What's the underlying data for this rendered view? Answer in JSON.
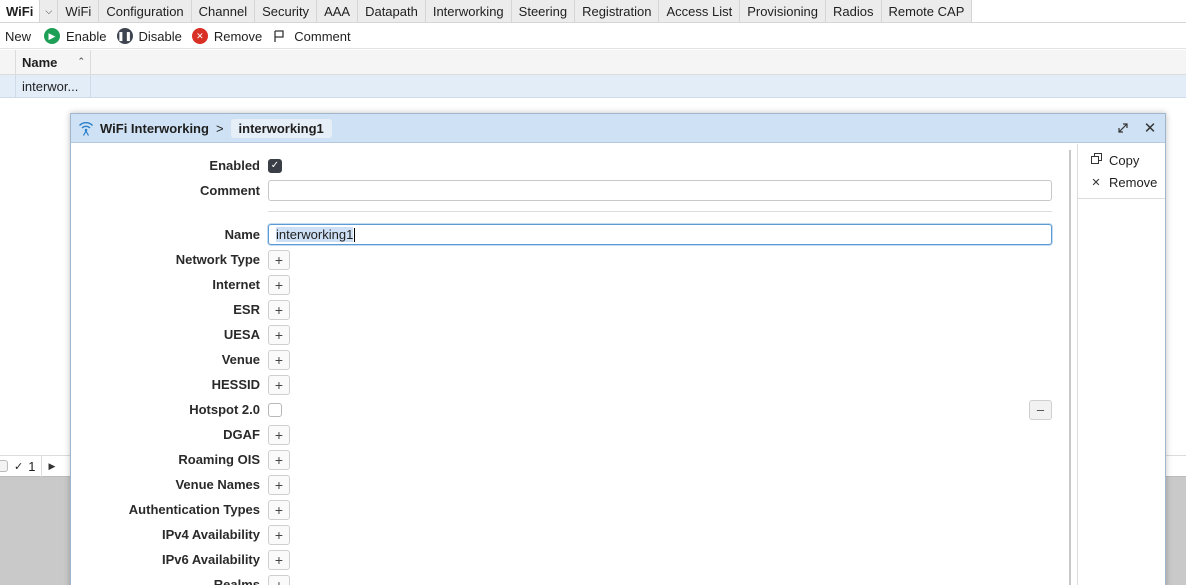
{
  "tabs": {
    "active": "WiFi",
    "items": [
      "WiFi",
      "Configuration",
      "Channel",
      "Security",
      "AAA",
      "Datapath",
      "Interworking",
      "Steering",
      "Registration",
      "Access List",
      "Provisioning",
      "Radios",
      "Remote CAP"
    ]
  },
  "toolbar": {
    "new_label": "New",
    "enable_label": "Enable",
    "disable_label": "Disable",
    "remove_label": "Remove",
    "comment_label": "Comment"
  },
  "table": {
    "columns": [
      "Name"
    ],
    "rows": [
      {
        "name": "interwor..."
      }
    ]
  },
  "statusbar": {
    "count": "1"
  },
  "dialog": {
    "title": "WiFi Interworking",
    "separator": ">",
    "item_name": "interworking1",
    "side_actions": {
      "copy_label": "Copy",
      "remove_label": "Remove"
    },
    "fields": {
      "enabled": {
        "label": "Enabled",
        "checked": true
      },
      "comment": {
        "label": "Comment",
        "value": ""
      },
      "name": {
        "label": "Name",
        "value": "interworking1"
      },
      "network_type": {
        "label": "Network Type"
      },
      "internet": {
        "label": "Internet"
      },
      "esr": {
        "label": "ESR"
      },
      "uesa": {
        "label": "UESA"
      },
      "venue": {
        "label": "Venue"
      },
      "hessid": {
        "label": "HESSID"
      },
      "hotspot20": {
        "label": "Hotspot 2.0",
        "checked": false
      },
      "dgaf": {
        "label": "DGAF"
      },
      "roaming_ois": {
        "label": "Roaming OIS"
      },
      "venue_names": {
        "label": "Venue Names"
      },
      "auth_types": {
        "label": "Authentication Types"
      },
      "ipv4": {
        "label": "IPv4 Availability"
      },
      "ipv6": {
        "label": "IPv6 Availability"
      },
      "realms": {
        "label": "Realms"
      }
    }
  },
  "colors": {
    "accent": "#5b9bd5",
    "title_bar": "#cfe2f5",
    "selected_row": "#e3edf8",
    "enable_green": "#1e9f56",
    "remove_red": "#d93025"
  }
}
